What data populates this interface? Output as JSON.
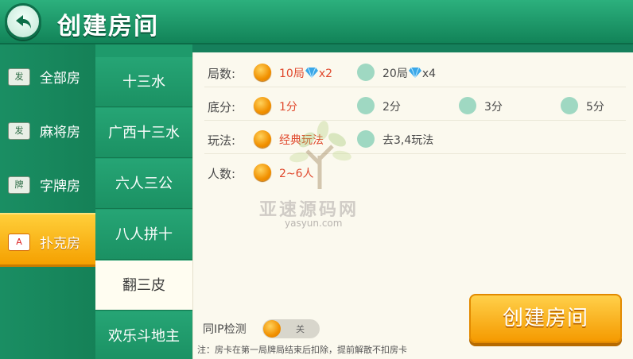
{
  "header": {
    "title": "创建房间"
  },
  "categories": [
    {
      "label": "全部房",
      "icon": "发"
    },
    {
      "label": "麻将房",
      "icon": "发"
    },
    {
      "label": "字牌房",
      "icon": "牌"
    },
    {
      "label": "扑克房",
      "icon": "A"
    }
  ],
  "active_category": "扑克房",
  "games": [
    "十三水",
    "广西十三水",
    "六人三公",
    "八人拼十",
    "翻三皮",
    "欢乐斗地主"
  ],
  "active_game": "翻三皮",
  "settings": {
    "rounds": {
      "label": "局数:",
      "options": [
        {
          "text": "10局",
          "gem": "x2",
          "selected": true
        },
        {
          "text": "20局",
          "gem": "x4",
          "selected": false
        }
      ]
    },
    "base": {
      "label": "底分:",
      "options": [
        {
          "text": "1分",
          "selected": true
        },
        {
          "text": "2分",
          "selected": false
        },
        {
          "text": "3分",
          "selected": false
        },
        {
          "text": "5分",
          "selected": false
        }
      ]
    },
    "mode": {
      "label": "玩法:",
      "options": [
        {
          "text": "经典玩法",
          "selected": true
        },
        {
          "text": "去3,4玩法",
          "selected": false
        }
      ]
    },
    "players": {
      "label": "人数:",
      "options": [
        {
          "text": "2~6人",
          "selected": true
        }
      ]
    }
  },
  "watermark": {
    "text": "亚速源码网",
    "url": "yasyun.com"
  },
  "ip_check": {
    "label": "同IP检测",
    "state": "关"
  },
  "note": "注：房卡在第一局牌局结束后扣除，提前解散不扣房卡",
  "create_button": "创建房间"
}
